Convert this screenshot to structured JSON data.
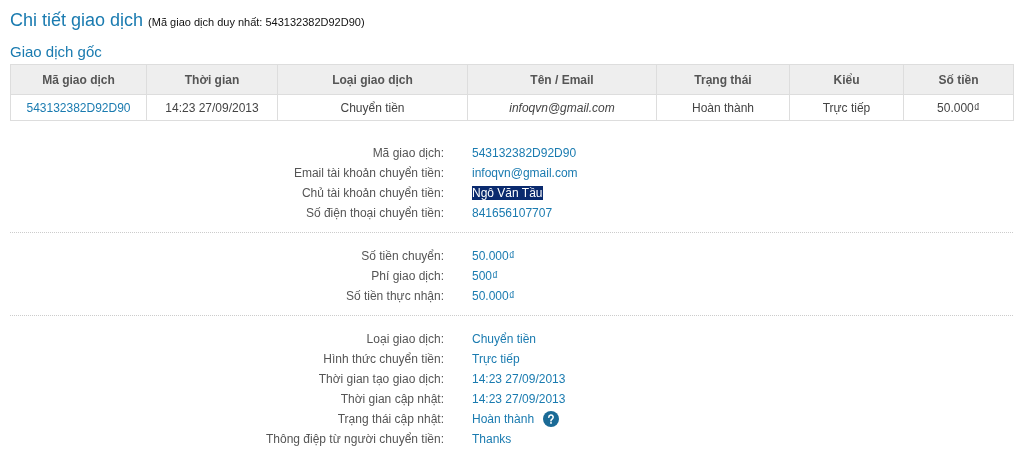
{
  "title": "Chi tiết giao dịch",
  "subtitle": "(Mã giao dịch duy nhất: 543132382D92D90)",
  "section_title": "Giao dịch gốc",
  "table": {
    "columns": [
      "Mã giao dịch",
      "Thời gian",
      "Loại giao dịch",
      "Tên / Email",
      "Trạng thái",
      "Kiểu",
      "Số tiền"
    ],
    "rows": [
      [
        "543132382D92D90",
        "14:23 27/09/2013",
        "Chuyển tiền",
        "infoqvn@gmail.com",
        "Hoàn thành",
        "Trực tiếp",
        "50.000₫"
      ]
    ]
  },
  "groups": [
    {
      "fields": [
        {
          "label": "Mã giao dịch:",
          "value": "543132382D92D90",
          "highlighted": false,
          "help": false
        },
        {
          "label": "Email tài khoản chuyển tiền:",
          "value": "infoqvn@gmail.com",
          "highlighted": false,
          "help": false
        },
        {
          "label": "Chủ tài khoản chuyển tiền:",
          "value": "Ngô Văn Tầu",
          "highlighted": true,
          "help": false
        },
        {
          "label": "Số điện thoại chuyển tiền:",
          "value": "841656107707",
          "highlighted": false,
          "help": false
        }
      ]
    },
    {
      "fields": [
        {
          "label": "Số tiền chuyển:",
          "value": "50.000₫",
          "highlighted": false,
          "help": false
        },
        {
          "label": "Phí giao dịch:",
          "value": "500₫",
          "highlighted": false,
          "help": false
        },
        {
          "label": "Số tiền thực nhận:",
          "value": "50.000₫",
          "highlighted": false,
          "help": false
        }
      ]
    },
    {
      "fields": [
        {
          "label": "Loại giao dịch:",
          "value": "Chuyển tiền",
          "highlighted": false,
          "help": false
        },
        {
          "label": "Hình thức chuyển tiền:",
          "value": "Trực tiếp",
          "highlighted": false,
          "help": false
        },
        {
          "label": "Thời gian tạo giao dịch:",
          "value": "14:23 27/09/2013",
          "highlighted": false,
          "help": false
        },
        {
          "label": "Thời gian cập nhật:",
          "value": "14:23 27/09/2013",
          "highlighted": false,
          "help": false
        },
        {
          "label": "Trạng thái cập nhật:",
          "value": "Hoàn thành",
          "highlighted": false,
          "help": true
        },
        {
          "label": "Thông điệp từ người chuyển tiền:",
          "value": "Thanks",
          "highlighted": false,
          "help": false
        }
      ]
    }
  ]
}
